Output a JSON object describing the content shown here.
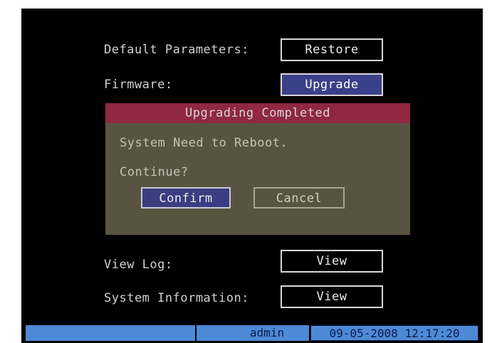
{
  "settings": {
    "default_parameters": {
      "label": "Default Parameters:",
      "button": "Restore"
    },
    "firmware": {
      "label": "Firmware:",
      "button": "Upgrade"
    },
    "view_log": {
      "label": "View Log:",
      "button": "View"
    },
    "system_information": {
      "label": "System Information:",
      "button": "View"
    }
  },
  "dialog": {
    "title": "Upgrading Completed",
    "message": "System Need to Reboot.",
    "question": "Continue?",
    "confirm_label": "Confirm",
    "cancel_label": "Cancel"
  },
  "status_bar": {
    "user": "admin",
    "datetime": "09-05-2008 12:17:20"
  },
  "colors": {
    "screen_bg": "#000000",
    "dialog_bg": "#595442",
    "dialog_title_bg": "#8f2840",
    "focused_button_bg": "#3a3f8a",
    "status_bar_bg": "#4d8ad6"
  }
}
